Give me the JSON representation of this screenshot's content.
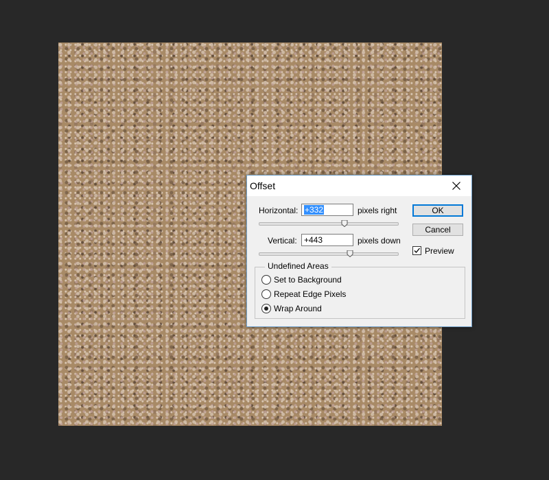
{
  "dialog": {
    "title": "Offset",
    "horizontal": {
      "label": "Horizontal:",
      "value": "+332",
      "unit": "pixels right",
      "slider_fraction": 0.62
    },
    "vertical": {
      "label": "Vertical:",
      "value": "+443",
      "unit": "pixels down",
      "slider_fraction": 0.66
    },
    "ok_label": "OK",
    "cancel_label": "Cancel",
    "preview": {
      "label": "Preview",
      "checked": true
    },
    "undefined_areas": {
      "legend": "Undefined Areas",
      "options": [
        {
          "label": "Set to Background",
          "selected": false
        },
        {
          "label": "Repeat Edge Pixels",
          "selected": false
        },
        {
          "label": "Wrap Around",
          "selected": true
        }
      ]
    }
  },
  "colors": {
    "accent": "#0078d7",
    "selection": "#3390ff",
    "workspace": "#282828"
  }
}
